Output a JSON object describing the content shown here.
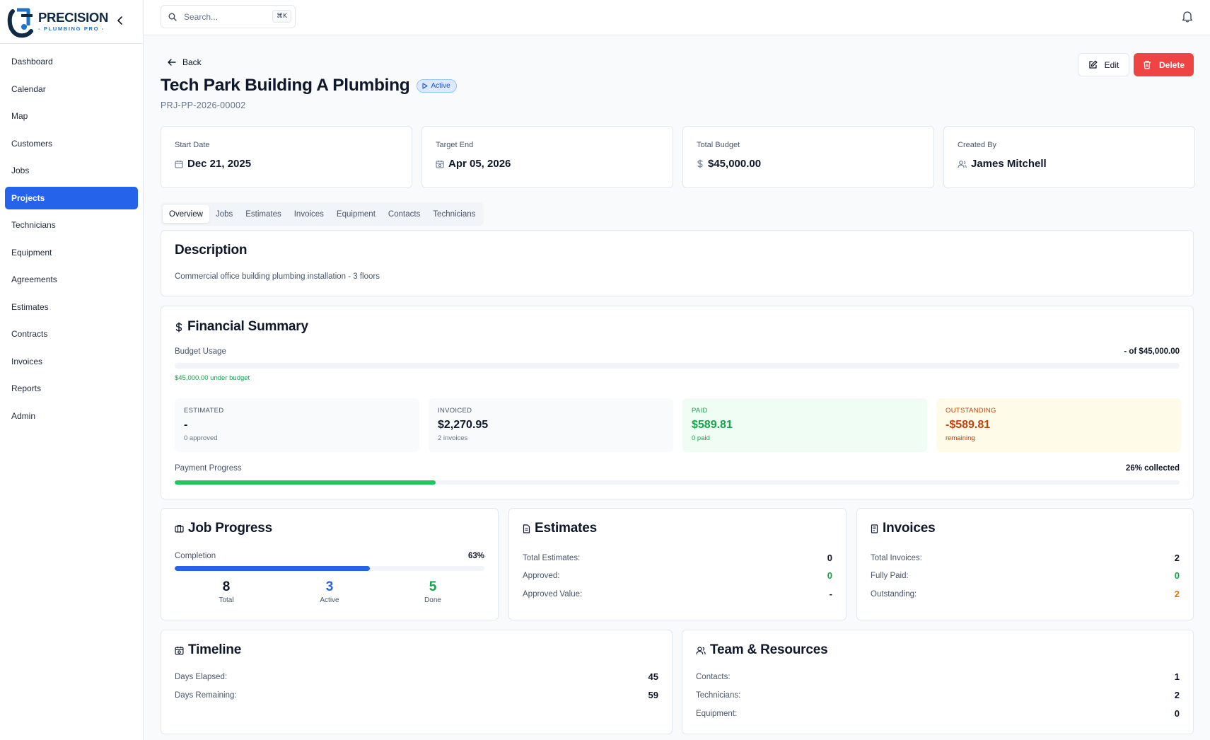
{
  "brand": {
    "name": "PRECISION",
    "tagline": "- PLUMBING PRO -"
  },
  "sidebar": {
    "items": [
      {
        "label": "Dashboard"
      },
      {
        "label": "Calendar"
      },
      {
        "label": "Map"
      },
      {
        "label": "Customers"
      },
      {
        "label": "Jobs"
      },
      {
        "label": "Projects",
        "active": true
      },
      {
        "label": "Technicians"
      },
      {
        "label": "Equipment"
      },
      {
        "label": "Agreements"
      },
      {
        "label": "Estimates"
      },
      {
        "label": "Contracts"
      },
      {
        "label": "Invoices"
      },
      {
        "label": "Reports"
      },
      {
        "label": "Admin"
      }
    ]
  },
  "search": {
    "placeholder": "Search...",
    "shortcut": "⌘K"
  },
  "header": {
    "back_label": "Back",
    "title": "Tech Park Building A Plumbing",
    "status": "Active",
    "project_number": "PRJ-PP-2026-00002",
    "edit_label": "Edit",
    "delete_label": "Delete"
  },
  "stats": [
    {
      "label": "Start Date",
      "value": "Dec 21, 2025",
      "icon": "calendar-icon"
    },
    {
      "label": "Target End",
      "value": "Apr 05, 2026",
      "icon": "calendar-clock-icon"
    },
    {
      "label": "Total Budget",
      "value": "$45,000.00",
      "icon": "dollar-icon"
    },
    {
      "label": "Created By",
      "value": "James Mitchell",
      "icon": "users-icon"
    }
  ],
  "tabs": [
    "Overview",
    "Jobs",
    "Estimates",
    "Invoices",
    "Equipment",
    "Contacts",
    "Technicians"
  ],
  "description": {
    "title": "Description",
    "text": "Commercial office building plumbing installation - 3 floors"
  },
  "financial": {
    "title": "Financial Summary",
    "budget_usage_label": "Budget Usage",
    "budget_usage_value": "- of $45,000.00",
    "budget_usage_fraction": 0,
    "under_budget": "$45,000.00 under budget",
    "tiles": {
      "estimated": {
        "label": "ESTIMATED",
        "value": "-",
        "sub": "0 approved"
      },
      "invoiced": {
        "label": "INVOICED",
        "value": "$2,270.95",
        "sub": "2 invoices"
      },
      "paid": {
        "label": "PAID",
        "value": "$589.81",
        "sub": "0 paid"
      },
      "outstanding": {
        "label": "OUTSTANDING",
        "value": "-$589.81",
        "sub": "remaining"
      }
    },
    "payment_progress_label": "Payment Progress",
    "payment_progress_value": "26% collected",
    "payment_progress_percent": 26
  },
  "job_progress": {
    "title": "Job Progress",
    "completion_label": "Completion",
    "completion_value": "63%",
    "completion_percent": 63,
    "total": "8",
    "total_label": "Total",
    "active": "3",
    "active_label": "Active",
    "done": "5",
    "done_label": "Done"
  },
  "estimates": {
    "title": "Estimates",
    "rows": [
      {
        "label": "Total Estimates:",
        "value": "0"
      },
      {
        "label": "Approved:",
        "value": "0"
      },
      {
        "label": "Approved Value:",
        "value": "-"
      }
    ]
  },
  "invoices": {
    "title": "Invoices",
    "rows": [
      {
        "label": "Total Invoices:",
        "value": "2"
      },
      {
        "label": "Fully Paid:",
        "value": "0"
      },
      {
        "label": "Outstanding:",
        "value": "2"
      }
    ]
  },
  "timeline": {
    "title": "Timeline",
    "rows": [
      {
        "label": "Days Elapsed:",
        "value": "45"
      },
      {
        "label": "Days Remaining:",
        "value": "59"
      }
    ]
  },
  "team": {
    "title": "Team & Resources",
    "rows": [
      {
        "label": "Contacts:",
        "value": "1"
      },
      {
        "label": "Technicians:",
        "value": "2"
      },
      {
        "label": "Equipment:",
        "value": "0"
      }
    ]
  },
  "colors": {
    "primary": "#2563eb",
    "danger": "#ef4444",
    "success": "#16a34a",
    "warning": "#d97706"
  }
}
